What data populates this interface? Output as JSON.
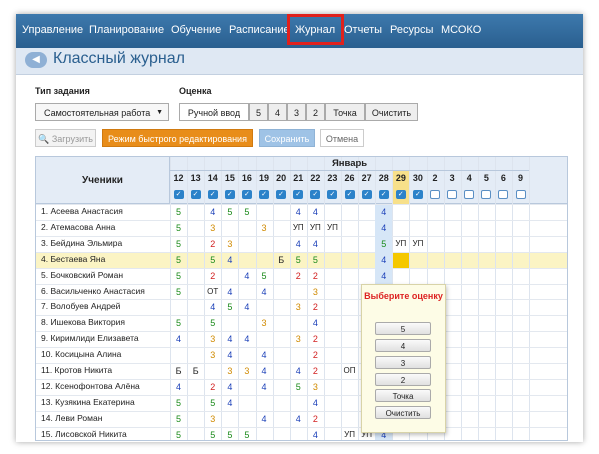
{
  "nav": {
    "items": [
      "Управление",
      "Планирование",
      "Обучение",
      "Расписание",
      "Журнал",
      "Отчеты",
      "Ресурсы",
      "МСОКО"
    ],
    "active": "Журнал"
  },
  "page_title": "Классный журнал",
  "task": {
    "type_label": "Тип задания",
    "type_value": "Самостоятельная работа",
    "grade_label": "Оценка",
    "grade_buttons": [
      "Ручной ввод",
      "5",
      "4",
      "3",
      "2",
      "Точка",
      "Очистить"
    ]
  },
  "toolbar": {
    "load": "Загрузить",
    "quick_edit": "Режим быстрого редактирования",
    "save": "Сохранить",
    "cancel": "Отмена"
  },
  "table": {
    "students_header": "Ученики",
    "month": "Январь",
    "days": [
      "12",
      "13",
      "14",
      "15",
      "16",
      "19",
      "20",
      "21",
      "22",
      "23",
      "26",
      "27",
      "28",
      "29",
      "30",
      "2",
      "3",
      "4",
      "5",
      "6",
      "9"
    ],
    "checked_days": 15,
    "highlight_day_index": 13,
    "selected_row_index": 3,
    "students": [
      {
        "name": "1. Асеева Анастасия",
        "grades": [
          "5",
          "",
          "4",
          "5",
          "5",
          "",
          "",
          "4",
          "4",
          "",
          "",
          "",
          "4",
          "",
          "",
          "",
          "",
          "",
          "",
          "",
          ""
        ]
      },
      {
        "name": "2. Атемасова Анна",
        "grades": [
          "5",
          "",
          "3",
          "",
          "",
          "3",
          "",
          "УП",
          "УП",
          "УП",
          "",
          "",
          "4",
          "",
          "",
          "",
          "",
          "",
          "",
          "",
          ""
        ]
      },
      {
        "name": "3. Бейдина Эльмира",
        "grades": [
          "5",
          "",
          "2",
          "3",
          "",
          "",
          "",
          "4",
          "4",
          "",
          "",
          "",
          "5",
          "УП",
          "УП",
          "",
          "",
          "",
          "",
          "",
          ""
        ]
      },
      {
        "name": "4. Бестаева Яна",
        "grades": [
          "5",
          "",
          "5",
          "4",
          "",
          "",
          "Б",
          "5",
          "5",
          "",
          "",
          "",
          "4",
          "",
          "",
          "",
          "",
          "",
          "",
          "",
          ""
        ]
      },
      {
        "name": "5. Бочковский Роман",
        "grades": [
          "5",
          "",
          "2",
          "",
          "4",
          "5",
          "",
          "2",
          "2",
          "",
          "",
          "",
          "4",
          "",
          "",
          "",
          "",
          "",
          "",
          "",
          ""
        ]
      },
      {
        "name": "6. Васильченко Анастасия",
        "grades": [
          "5",
          "",
          "ОТ",
          "4",
          "",
          "4",
          "",
          "",
          "3",
          "",
          "",
          "",
          "4",
          "",
          "",
          "",
          "",
          "",
          "",
          "",
          ""
        ]
      },
      {
        "name": "7. Волобуев Андрей",
        "grades": [
          "",
          "",
          "4",
          "5",
          "4",
          "",
          "",
          "3",
          "2",
          "",
          "",
          "",
          "4",
          "",
          "",
          "",
          "",
          "",
          "",
          "",
          ""
        ]
      },
      {
        "name": "8. Ишекова Виктория",
        "grades": [
          "5",
          "",
          "5",
          "",
          "",
          "3",
          "",
          "",
          "4",
          "",
          "",
          "",
          "4",
          "",
          "",
          "",
          "",
          "",
          "",
          "",
          ""
        ]
      },
      {
        "name": "9. Киримлиди Елизавета",
        "grades": [
          "4",
          "",
          "3",
          "4",
          "4",
          "",
          "",
          "3",
          "2",
          "",
          "",
          "",
          "4",
          "",
          "",
          "",
          "",
          "",
          "",
          "",
          ""
        ]
      },
      {
        "name": "10. Косицына Алина",
        "grades": [
          "",
          "",
          "3",
          "4",
          "",
          "4",
          "",
          "",
          "2",
          "",
          "",
          "",
          "4",
          "",
          "",
          "",
          "",
          "",
          "",
          "",
          ""
        ]
      },
      {
        "name": "11. Кротов Никита",
        "grades": [
          "Б",
          "Б",
          "",
          "3",
          "3",
          "4",
          "",
          "4",
          "2",
          "",
          "ОП",
          "",
          "4",
          "",
          "",
          "",
          "",
          "",
          "",
          "",
          ""
        ]
      },
      {
        "name": "12. Ксенофонтова Алёна",
        "grades": [
          "4",
          "",
          "2",
          "4",
          "",
          "4",
          "",
          "5",
          "3",
          "",
          "",
          "",
          "4",
          "",
          "",
          "",
          "",
          "",
          "",
          "",
          ""
        ]
      },
      {
        "name": "13. Кузякина Екатерина",
        "grades": [
          "5",
          "",
          "5",
          "4",
          "",
          "",
          "",
          "",
          "4",
          "",
          "",
          "",
          "4",
          "",
          "",
          "",
          "",
          "",
          "",
          "",
          ""
        ]
      },
      {
        "name": "14. Леви Роман",
        "grades": [
          "5",
          "",
          "3",
          "",
          "",
          "4",
          "",
          "4",
          "2",
          "",
          "",
          "",
          "4",
          "",
          "",
          "",
          "",
          "",
          "",
          "",
          ""
        ]
      },
      {
        "name": "15. Лисовской Никита",
        "grades": [
          "5",
          "",
          "5",
          "5",
          "5",
          "",
          "",
          "",
          "4",
          "",
          "УП",
          "УП",
          "4",
          "",
          "",
          "",
          "",
          "",
          "",
          "",
          ""
        ]
      }
    ]
  },
  "popup": {
    "title": "Выберите оценку",
    "options": [
      "5",
      "4",
      "3",
      "2",
      "Точка",
      "Очистить"
    ]
  },
  "colors": {
    "nav_bg": "#2a5f8f",
    "grade_5": "#1a8a1a",
    "grade_4": "#1a3fb8",
    "grade_3": "#d08a00",
    "grade_2": "#d22020",
    "quick_edit": "#e88d1a",
    "selected_row": "#fbf4c4",
    "highlight_day": "#f7e08a"
  }
}
